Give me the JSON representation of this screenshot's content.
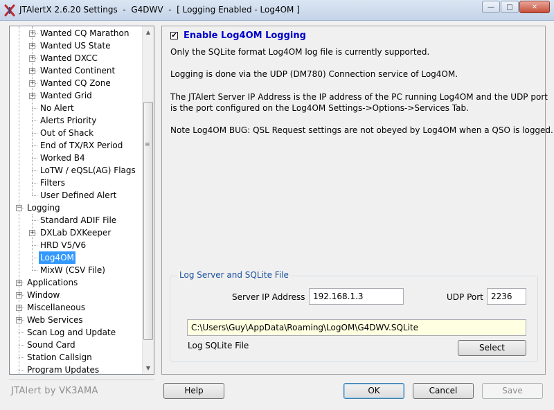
{
  "window": {
    "title": "JTAlertX 2.6.20 Settings  -  G4DWV  -  [ Logging Enabled - Log4OM ]",
    "minimize_icon": "minimize-icon",
    "maximize_icon": "maximize-icon",
    "close_icon": "close-icon"
  },
  "tree": {
    "items": [
      {
        "label": "Wanted CQ Marathon",
        "level": 2,
        "expander": "+"
      },
      {
        "label": "Wanted US State",
        "level": 2,
        "expander": "+"
      },
      {
        "label": "Wanted DXCC",
        "level": 2,
        "expander": "+"
      },
      {
        "label": "Wanted Continent",
        "level": 2,
        "expander": "+"
      },
      {
        "label": "Wanted CQ Zone",
        "level": 2,
        "expander": "+"
      },
      {
        "label": "Wanted Grid",
        "level": 2,
        "expander": "+"
      },
      {
        "label": "No Alert",
        "level": 2,
        "expander": ""
      },
      {
        "label": "Alerts Priority",
        "level": 2,
        "expander": ""
      },
      {
        "label": "Out of Shack",
        "level": 2,
        "expander": ""
      },
      {
        "label": "End of TX/RX Period",
        "level": 2,
        "expander": ""
      },
      {
        "label": "Worked B4",
        "level": 2,
        "expander": ""
      },
      {
        "label": "LoTW / eQSL(AG) Flags",
        "level": 2,
        "expander": ""
      },
      {
        "label": "Filters",
        "level": 2,
        "expander": ""
      },
      {
        "label": "User Defined Alert",
        "level": 2,
        "expander": ""
      },
      {
        "label": "Logging",
        "level": 1,
        "expander": "−"
      },
      {
        "label": "Standard ADIF File",
        "level": 2,
        "expander": ""
      },
      {
        "label": "DXLab DXKeeper",
        "level": 2,
        "expander": "+"
      },
      {
        "label": "HRD V5/V6",
        "level": 2,
        "expander": ""
      },
      {
        "label": "Log4OM",
        "level": 2,
        "expander": "",
        "selected": true
      },
      {
        "label": "MixW (CSV File)",
        "level": 2,
        "expander": ""
      },
      {
        "label": "Applications",
        "level": 1,
        "expander": "+"
      },
      {
        "label": "Window",
        "level": 1,
        "expander": "+"
      },
      {
        "label": "Miscellaneous",
        "level": 1,
        "expander": "+"
      },
      {
        "label": "Web Services",
        "level": 1,
        "expander": "+"
      },
      {
        "label": "Scan Log and Update",
        "level": 1,
        "expander": ""
      },
      {
        "label": "Sound Card",
        "level": 1,
        "expander": ""
      },
      {
        "label": "Station Callsign",
        "level": 1,
        "expander": ""
      },
      {
        "label": "Program Updates",
        "level": 1,
        "expander": ""
      }
    ]
  },
  "panel": {
    "enable_checked": true,
    "enable_label": "Enable Log4OM Logging",
    "info_lines": [
      "Only the SQLite format Log4OM log file is currently supported.",
      "Logging is done via the UDP (DM780) Connection service of Log4OM.",
      "The JTAlert Server IP Address is the IP address of the PC running Log4OM and the UDP port\nis the port configured on the Log4OM Settings->Options->Services Tab.",
      "Note Log4OM BUG: QSL Request settings are not obeyed by Log4OM when a QSO is logged."
    ],
    "group_title": "Log Server and SQLite File",
    "server_ip_label": "Server IP Address",
    "server_ip_value": "192.168.1.3",
    "udp_port_label": "UDP Port",
    "udp_port_value": "2236",
    "sqlite_path": "C:\\Users\\Guy\\AppData\\Roaming\\LogOM\\G4DWV.SQLite",
    "sqlite_label": "Log SQLite File",
    "select_button": "Select"
  },
  "footer": {
    "brand": "JTAlert by VK3AMA",
    "help": "Help",
    "ok": "OK",
    "cancel": "Cancel",
    "save": "Save"
  }
}
